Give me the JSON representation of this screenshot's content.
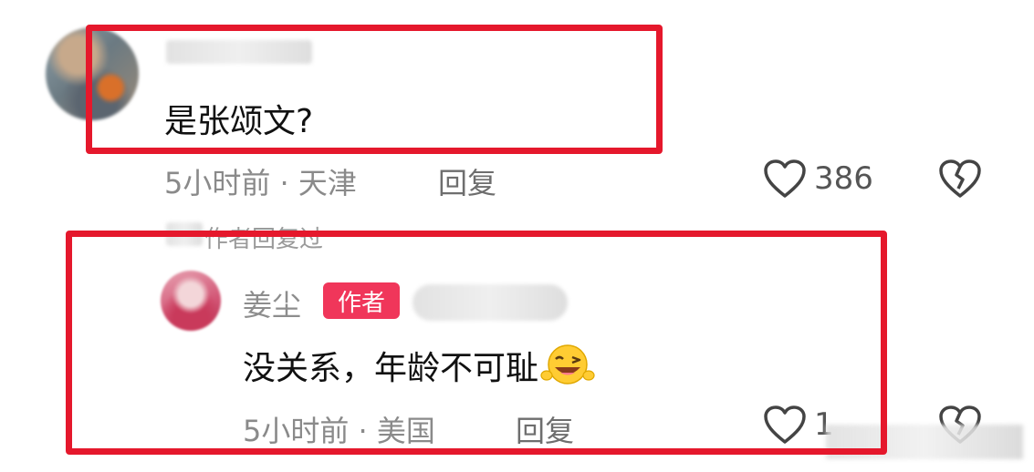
{
  "main_comment": {
    "text": "是张颂文?",
    "time_location": "5小时前 · 天津",
    "reply_label": "回复",
    "likes": "386"
  },
  "author_replied_label": "作者回复过",
  "reply_comment": {
    "username": "姜尘",
    "badge": "作者",
    "text": "没关系，年龄不可耻",
    "time_location": "5小时前 · 美国",
    "reply_label": "回复",
    "likes": "1"
  },
  "colors": {
    "highlight": "#e5182c",
    "badge": "#f0365a",
    "meta_text": "#8a8a8a"
  },
  "icons": {
    "like": "heart-outline-icon",
    "dislike": "broken-heart-icon",
    "emoji": "laughing-wink-emoji-icon"
  }
}
